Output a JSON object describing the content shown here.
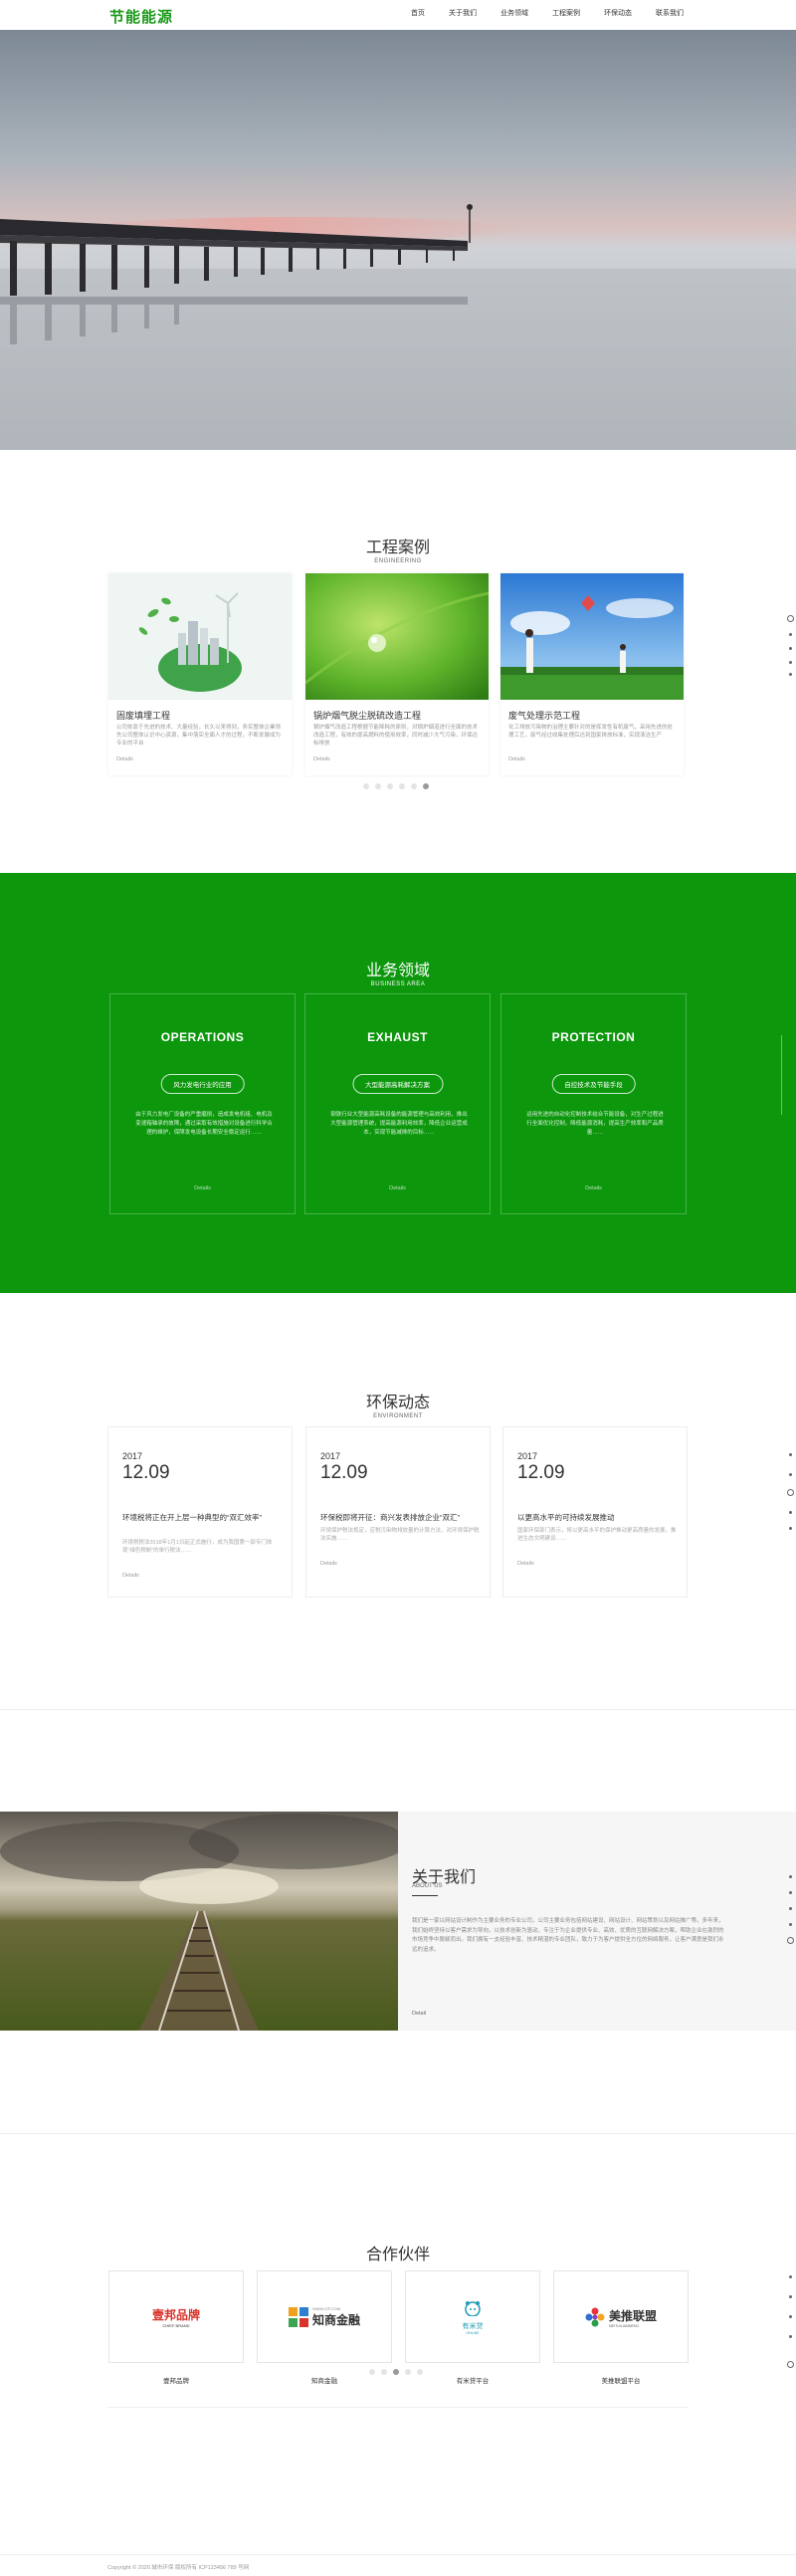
{
  "header": {
    "logo": "节能能源",
    "nav": [
      "首页",
      "关于我们",
      "业务领域",
      "工程案例",
      "环保动态",
      "联系我们"
    ]
  },
  "engineering": {
    "title": "工程案例",
    "subtitle": "ENGINEERING",
    "cards": [
      {
        "title": "固废填埋工程",
        "desc": "公司依靠于先进的技术、大量经验，长久以来得到，务实整体企業领先公司整体认识中心资源，集中落实全面人才的过程，不断发展成为专业的平台",
        "more": "Details"
      },
      {
        "title": "锅炉烟气脱尘脱硫改造工程",
        "desc": "锅炉烟气改造工程根据节能降耗的原则，对锅炉烟道进行全面的技术改造工程，有效的提高燃料的使用效率，同时减少大气污染，环保达标排放",
        "more": "Details"
      },
      {
        "title": "废气处理示范工程",
        "desc": "化工排放污染物的治理主要针对的是挥发性有机废气，采用先进的处理工艺，废气经过收集处理后达到国家排放标准，实现清洁生产",
        "more": "Details"
      }
    ]
  },
  "business": {
    "title": "业务领域",
    "subtitle": "BUSINESS AREA",
    "cards": [
      {
        "heading": "OPERATIONS",
        "pill": "风力发电行业的应用",
        "desc": "由于风力发电厂设备的严重磨损，造成发电机组、电机及变速箱轴承的故障，通过采取有效措施对设备进行科学合理的维护，保障发电设备长期安全稳定运行……",
        "more": "Details"
      },
      {
        "heading": "EXHAUST",
        "pill": "大型能源高耗解决方案",
        "desc": "钢铁行业大型能源高耗设备的能源管理与高效利用，推出大型能源管理系统，提高能源利用效率，降低企业运营成本，实现节能减排的目标……",
        "more": "Details"
      },
      {
        "heading": "PROTECTION",
        "pill": "自控技术及节能手段",
        "desc": "运用先进的自动化控制技术结合节能设备，对生产过程进行全面优化控制，降低能源消耗，提高生产效率和产品质量……",
        "more": "Details"
      }
    ]
  },
  "environment": {
    "title": "环保动态",
    "subtitle": "ENVIRONMENT",
    "news": [
      {
        "year": "2017",
        "date": "12.09",
        "title": "环境税将正在开上层一种典型的“双汇效率”",
        "desc": "环境税税法2018年1月1日起正式施行，成为我国第一部专门体现“绿色税制”的单行税法……",
        "more": "Details"
      },
      {
        "year": "2017",
        "date": "12.09",
        "title": "环保税即将开征：商兴发表排放企业“双汇”",
        "desc": "环境保护税法规定，应税污染物排放量的计算方法，对环境保护税法实施……",
        "more": "Details"
      },
      {
        "year": "2017",
        "date": "12.09",
        "title": "以更高水平的可持续发展推动",
        "desc": "国家环保部门表示，将以更高水平的保护推动更高质量的发展，推进生态文明建设……",
        "more": "Details"
      }
    ]
  },
  "about": {
    "title": "关于我们",
    "subtitle": "ABOUT US",
    "desc": "我们是一家以网站设计制作为主要业务的专业公司，公司主要业务包括网站建设、网站设计、网站策划以及网站推广等。多年来，我们始终坚持以客户需求为导向，以技术创新为驱动，专注于为企业提供专业、高效、优质的互联网解决方案，帮助企业在激烈的市场竞争中脱颖而出。我们拥有一支经验丰富、技术精湛的专业团队，致力于为客户提供全方位的网络服务，让客户满意是我们永远的追求。",
    "more": "Detail"
  },
  "partners": {
    "title": "合作伙伴",
    "items": [
      {
        "logo": "壹邦品牌",
        "logo_sub": "CHIEF BRAND",
        "name": "壹邦品牌"
      },
      {
        "logo": "知商金融",
        "logo_sub": "WWW.IZF.COM",
        "name": "知商金融"
      },
      {
        "logo": "有米贷",
        "logo_sub": "ONLINE",
        "name": "有米贷平台"
      },
      {
        "logo": "美推联盟",
        "logo_sub": "MEITUILIANMENG",
        "name": "美推联盟平台"
      }
    ]
  },
  "footer": {
    "copyright": "Copyright © 2020 城市环保 版权所有 ICP123456 789 号网"
  },
  "colors": {
    "brand": "#1a9a1a",
    "business_bg": "#0c970c"
  }
}
